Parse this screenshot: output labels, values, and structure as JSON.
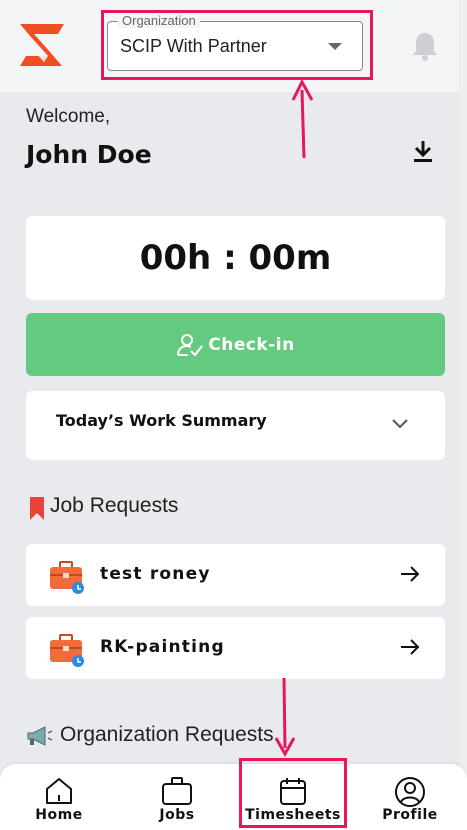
{
  "header": {
    "organization_legend": "Organization",
    "organization_value": "SCIP With Partner",
    "logo_icon": "brand-logo-icon",
    "notification_icon": "bell-icon"
  },
  "welcome": {
    "greeting": "Welcome,",
    "user_name": "John Doe",
    "download_icon": "download-icon"
  },
  "timer": {
    "display": "00h : 00m"
  },
  "checkin": {
    "label": "Check-in",
    "icon": "user-check-icon",
    "color": "#64ca80"
  },
  "summary": {
    "title": "Today’s Work Summary",
    "chevron_icon": "chevron-down-icon"
  },
  "job_requests": {
    "title": "Job Requests",
    "icon": "bookmark-icon",
    "items": [
      {
        "label": "test roney",
        "icon": "briefcase-icon",
        "action_icon": "arrow-right-icon"
      },
      {
        "label": "RK-painting",
        "icon": "briefcase-icon",
        "action_icon": "arrow-right-icon"
      }
    ]
  },
  "organization_requests": {
    "title": "Organization Requests",
    "icon": "megaphone-icon"
  },
  "bottom_nav": {
    "items": [
      {
        "label": "Home",
        "icon": "home-icon"
      },
      {
        "label": "Jobs",
        "icon": "briefcase-icon"
      },
      {
        "label": "Timesheets",
        "icon": "calendar-icon"
      },
      {
        "label": "Profile",
        "icon": "user-circle-icon"
      }
    ]
  },
  "colors": {
    "accent": "#f04e23",
    "annotation": "#e8175d",
    "success": "#64ca80"
  }
}
